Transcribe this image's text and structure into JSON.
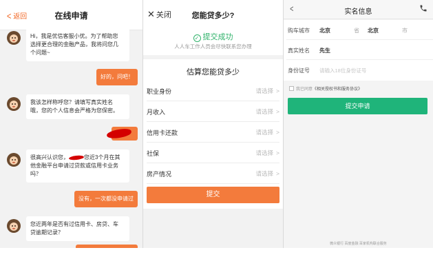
{
  "panel1": {
    "back_label": "返回",
    "title": "在线申请",
    "messages": [
      {
        "lines": [
          "Hi，我是优信客服小优。为了帮助您",
          "选择更合理的金融产品，我将问您几",
          "个问题~"
        ]
      },
      {
        "lines": [
          "好的，问吧！"
        ]
      },
      {
        "lines": [
          "我该怎样称呼您？请填写真实姓名",
          "哦，您的个人信息会严格为您保密。"
        ]
      },
      {
        "lines": [
          "很高兴认识您，",
          "您近3个月在其",
          "他金融平台申请过贷款或信用卡业务",
          "吗？"
        ]
      },
      {
        "lines": [
          "没有，一次都没申请过"
        ]
      },
      {
        "lines": [
          "您近两年是否有过信用卡、房贷、车",
          "贷逾期记录？"
        ]
      }
    ]
  },
  "panel2": {
    "close_label": "关闭",
    "title": "您能贷多少?",
    "success": "提交成功",
    "success_sub": "人人车工作人员会尽快联系您办理",
    "section_title": "估算您能贷多少",
    "rows": [
      {
        "label": "职业身份",
        "value": "请选择"
      },
      {
        "label": "月收入",
        "value": "请选择"
      },
      {
        "label": "信用卡还款",
        "value": "请选择"
      },
      {
        "label": "社保",
        "value": "请选择"
      },
      {
        "label": "房产情况",
        "value": "请选择"
      }
    ],
    "submit": "提交"
  },
  "panel3": {
    "title": "实名信息",
    "city_label": "购车城市",
    "province_value": "北京",
    "province_unit": "省",
    "city_value": "北京",
    "city_unit": "市",
    "name_label": "真实姓名",
    "name_value": "先生",
    "id_label": "身份证号",
    "id_placeholder": "请输入18位身份证号",
    "agree_prefix": "我已同意",
    "agree_link": "《相关授权书和服务协议》",
    "submit": "提交申请",
    "footer": "微众银行 百度金融 百家机构联合服务"
  },
  "colors": {
    "orange": "#f37b3c",
    "green": "#1fb47a",
    "success_green": "#2fb26a"
  }
}
